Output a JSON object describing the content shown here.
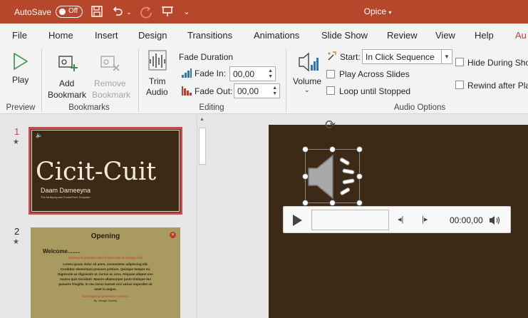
{
  "titlebar": {
    "autosave_label": "AutoSave",
    "autosave_state": "Off",
    "doc_title": "Opice",
    "icons": [
      "save-icon",
      "undo-icon",
      "redo-icon",
      "presentation-icon",
      "customize-icon"
    ]
  },
  "tabs": [
    {
      "label": "File"
    },
    {
      "label": "Home"
    },
    {
      "label": "Insert"
    },
    {
      "label": "Design"
    },
    {
      "label": "Transitions"
    },
    {
      "label": "Animations"
    },
    {
      "label": "Slide Show"
    },
    {
      "label": "Review"
    },
    {
      "label": "View"
    },
    {
      "label": "Help"
    },
    {
      "label": "Au"
    }
  ],
  "ribbon": {
    "preview": {
      "play_label": "Play",
      "group_label": "Preview"
    },
    "bookmarks": {
      "add_label_1": "Add",
      "add_label_2": "Bookmark",
      "remove_label_1": "Remove",
      "remove_label_2": "Bookmark",
      "group_label": "Bookmarks"
    },
    "editing": {
      "trim_label_1": "Trim",
      "trim_label_2": "Audio",
      "fade_duration_label": "Fade Duration",
      "fade_in_label": "Fade In:",
      "fade_in_value": "00,00",
      "fade_out_label": "Fade Out:",
      "fade_out_value": "00,00",
      "group_label": "Editing"
    },
    "audio_options": {
      "volume_label": "Volume",
      "start_label": "Start:",
      "start_value": "In Click Sequence",
      "play_across_label": "Play Across Slides",
      "loop_label": "Loop until Stopped",
      "hide_label": "Hide During Sho",
      "rewind_label": "Rewind after Pla",
      "group_label": "Audio Options"
    }
  },
  "slides": [
    {
      "number": "1",
      "title": "Cicit-Cuit",
      "subtitle": "Daam Dameeyna",
      "tagline": "The Multipurpose PowerPoint Template"
    },
    {
      "number": "2",
      "title": "Opening",
      "welcome": "Welcome........",
      "red_line": "Contrary to popular belief it has roots to Vikings Club",
      "body": [
        "Lorem ipsum dolor sit amet, consectetur adipiscing elit.",
        "Curabitur elementum posuere pretium. Quisque tempor mi.",
        "Dignissim ac dignissim ut, luctus ac urna. Aliquam aliquet non",
        "massa quis tincidunt. Mauris ullamcorper justo tristique dui",
        "posuere fringilla. In nec lacus laoreet orci varius imperdiet sit",
        "amet in augue,"
      ],
      "closing": "Start signing tambourine contest.",
      "signature": "By Vikings Society"
    }
  ],
  "player": {
    "time": "00:00,00"
  },
  "colors": {
    "brand": "#b7472a",
    "slide_bg": "#3c2a17",
    "thumb2_bg": "#a99a5f",
    "selected_border": "#c0504d"
  }
}
